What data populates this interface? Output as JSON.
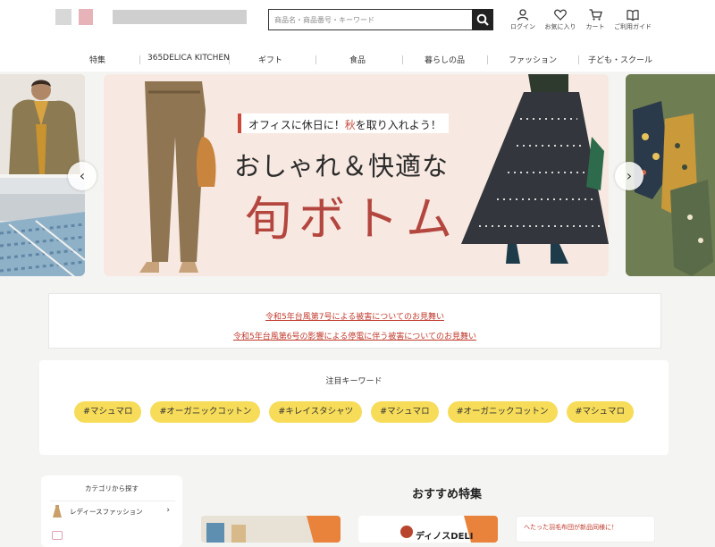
{
  "header": {
    "search_placeholder": "商品名・商品番号・キーワード",
    "utility": [
      "ログイン",
      "お気に入り",
      "カート",
      "ご利用ガイド"
    ]
  },
  "nav": [
    "特集",
    "365DELICA KITCHEN",
    "ギフト",
    "食品",
    "暮らしの品",
    "ファッション",
    "子ども・スクール"
  ],
  "banner": {
    "sub_pre": "オフィスに休日に！",
    "sub_hl": "秋",
    "sub_post": "を取り入れよう！",
    "main": "おしゃれ＆快適な",
    "big": "旬ボトム"
  },
  "notices": [
    "令和5年台風第7号による被害についてのお見舞い",
    "令和5年台風第6号の影響による停電に伴う被害についてのお見舞い"
  ],
  "keywords": {
    "title": "注目キーワード",
    "tags": [
      "#マシュマロ",
      "#オーガニックコットン",
      "#キレイスタシャツ",
      "#マシュマロ",
      "#オーガニックコットン",
      "#マシュマロ"
    ]
  },
  "category": {
    "title": "カテゴリから探す",
    "first_item": "レディースファッション"
  },
  "recommend": {
    "title": "おすすめ特集",
    "card2_text": "ディノスDELI",
    "card3_text": "へたった羽毛布団が新品同様に！"
  },
  "colors": {
    "accent": "#c94a3a",
    "keyword_tag": "#f7dc59",
    "notice_link": "#c0392b"
  }
}
